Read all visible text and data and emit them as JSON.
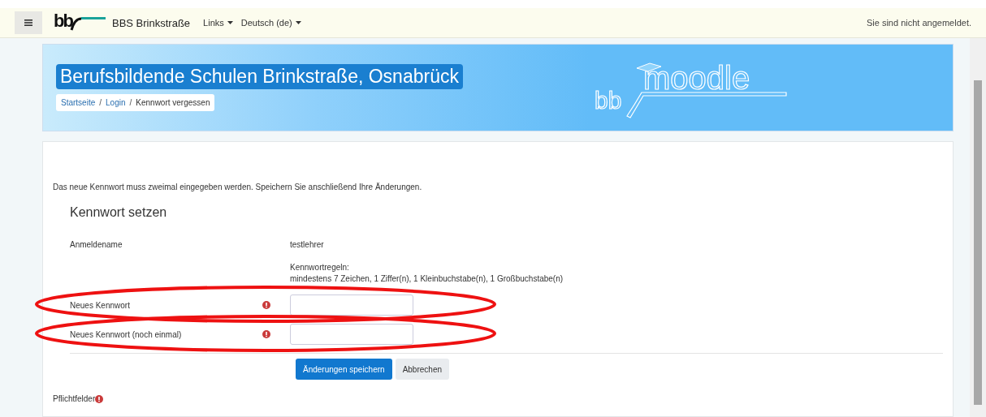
{
  "topbar": {
    "logo_text": "bb",
    "site_name": "BBS Brinkstraße",
    "menus": [
      {
        "label": "Links"
      },
      {
        "label": "Deutsch (de)"
      }
    ],
    "login_status": "Sie sind nicht angemeldet."
  },
  "banner": {
    "title": "Berufsbildende Schulen Brinkstraße, Osnabrück",
    "breadcrumb_separator": "/",
    "breadcrumb": [
      {
        "label": "Startseite",
        "link": true
      },
      {
        "label": "Login",
        "link": true
      },
      {
        "label": "Kennwort vergessen",
        "link": false
      }
    ],
    "logo_prefix": "bb",
    "logo_word": "moodle"
  },
  "intro": "Das neue Kennwort muss zweimal eingegeben werden. Speichern Sie anschließend Ihre Änderungen.",
  "form": {
    "heading": "Kennwort setzen",
    "rows": [
      {
        "kind": "static",
        "label": "Anmeldename",
        "value": "testlehrer"
      },
      {
        "kind": "note",
        "title": "Kennwortregeln:",
        "text": "mindestens 7 Zeichen, 1 Ziffer(n), 1 Kleinbuchstabe(n), 1 Großbuchstabe(n)"
      },
      {
        "kind": "input",
        "label": "Neues Kennwort",
        "required": true,
        "circled": true
      },
      {
        "kind": "input",
        "label": "Neues Kennwort (noch einmal)",
        "required": true,
        "circled": true
      }
    ],
    "buttons": [
      {
        "label": "Änderungen speichern",
        "primary": true
      },
      {
        "label": "Abbrechen",
        "primary": false
      }
    ],
    "required_note": "Pflichtfelder"
  }
}
